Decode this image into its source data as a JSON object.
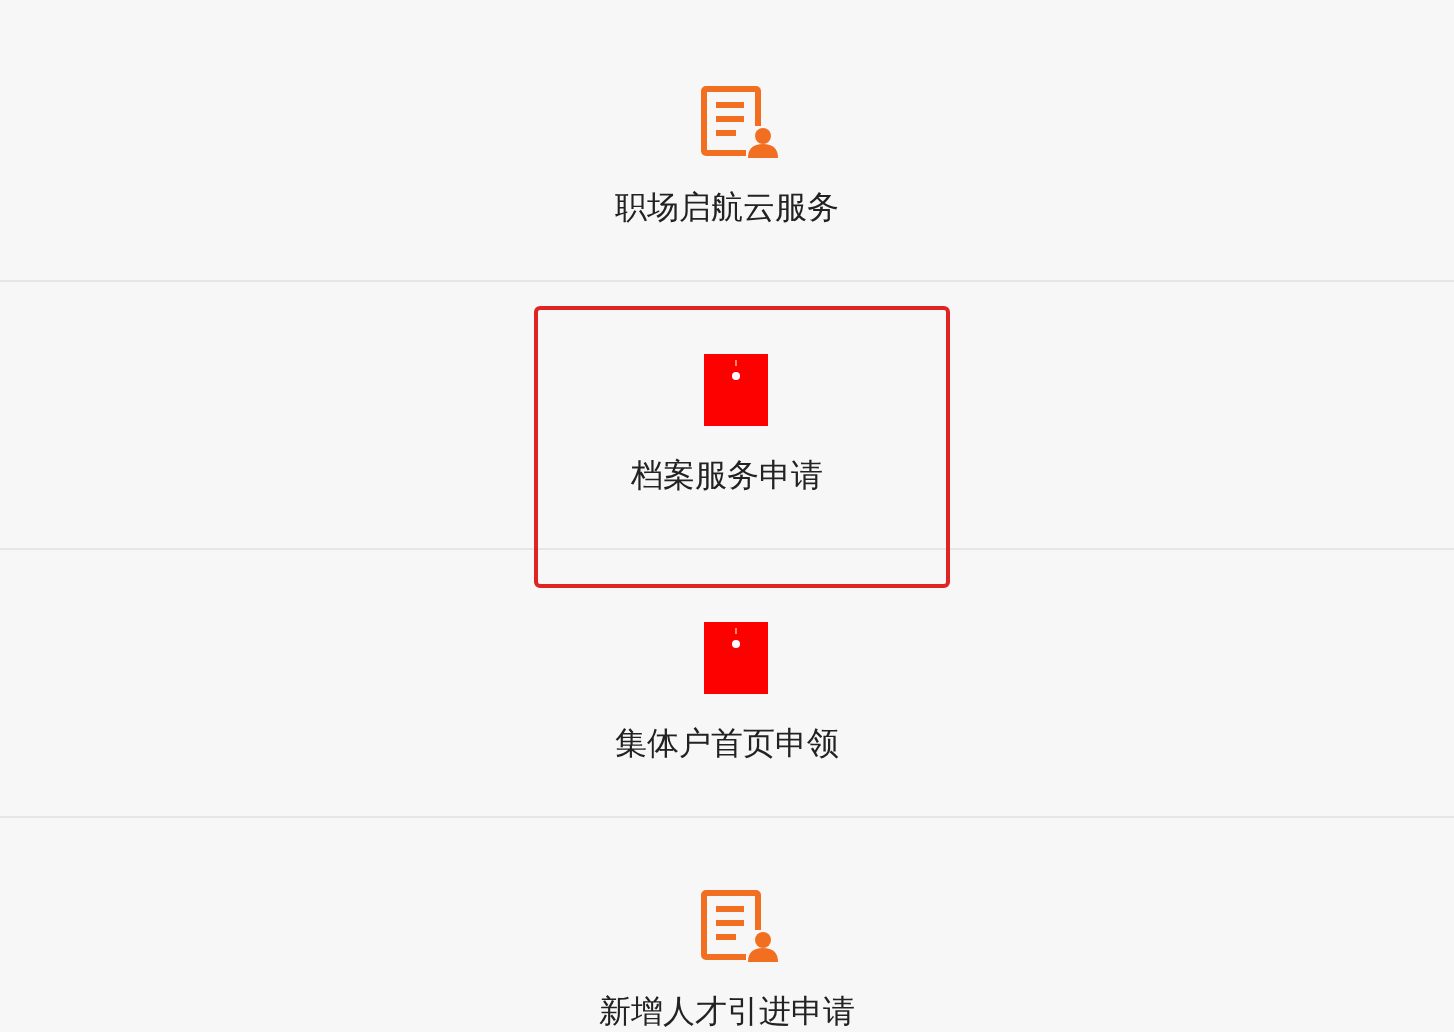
{
  "services": [
    {
      "label": "职场启航云服务",
      "kind": "document",
      "highlighted": false
    },
    {
      "label": "档案服务申请",
      "kind": "folder",
      "highlighted": true
    },
    {
      "label": "集体户首页申领",
      "kind": "folder",
      "highlighted": false
    },
    {
      "label": "新增人才引进申请",
      "kind": "document",
      "highlighted": false
    }
  ]
}
